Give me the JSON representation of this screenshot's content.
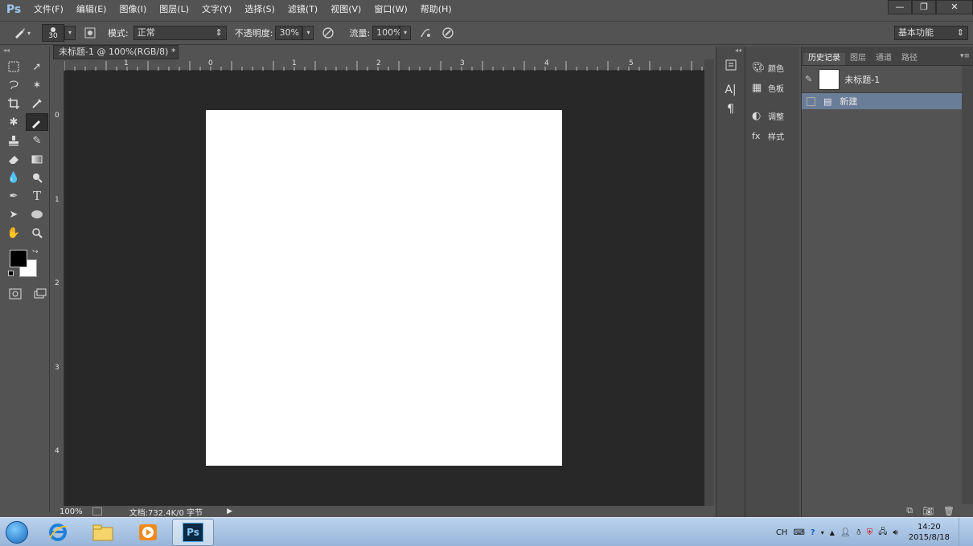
{
  "app": {
    "logo": "Ps"
  },
  "menu": [
    "文件(F)",
    "编辑(E)",
    "图像(I)",
    "图层(L)",
    "文字(Y)",
    "选择(S)",
    "滤镜(T)",
    "视图(V)",
    "窗口(W)",
    "帮助(H)"
  ],
  "window_controls": {
    "minimize": "—",
    "restore": "❐",
    "close": "✕"
  },
  "options_bar": {
    "brush_size": "30",
    "mode_label": "模式:",
    "mode_value": "正常",
    "opacity_label": "不透明度:",
    "opacity_value": "30%",
    "flow_label": "流量:",
    "flow_value": "100%",
    "workspace_value": "基本功能"
  },
  "document": {
    "tab_title": "未标题-1 @ 100%(RGB/8) *",
    "tab_close": "×",
    "ruler_top_ticks": [
      "1",
      "0",
      "1",
      "2",
      "3",
      "4",
      "5"
    ],
    "ruler_left_ticks": [
      "0",
      "1",
      "2",
      "3",
      "4"
    ],
    "zoom": "100%",
    "doc_info": "文档:732.4K/0 字节"
  },
  "side_panel": {
    "items": [
      {
        "label": "颜色",
        "icon": "palette-icon"
      },
      {
        "label": "色板",
        "icon": "swatches-icon"
      },
      {
        "label": "调整",
        "icon": "adjustments-icon"
      },
      {
        "label": "样式",
        "icon": "styles-icon"
      }
    ]
  },
  "history_panel": {
    "tabs": [
      "历史记录",
      "图层",
      "通道",
      "路径"
    ],
    "active_tab": "历史记录",
    "snapshot_label": "未标题-1",
    "history_items": [
      "新建"
    ]
  },
  "taskbar": {
    "apps": [
      "start-orb",
      "ie-icon",
      "explorer-icon",
      "media-player-icon",
      "photoshop-icon"
    ],
    "ps_label": "Ps",
    "tray_lang": "CH",
    "clock_time": "14:20",
    "clock_date": "2015/8/18"
  }
}
